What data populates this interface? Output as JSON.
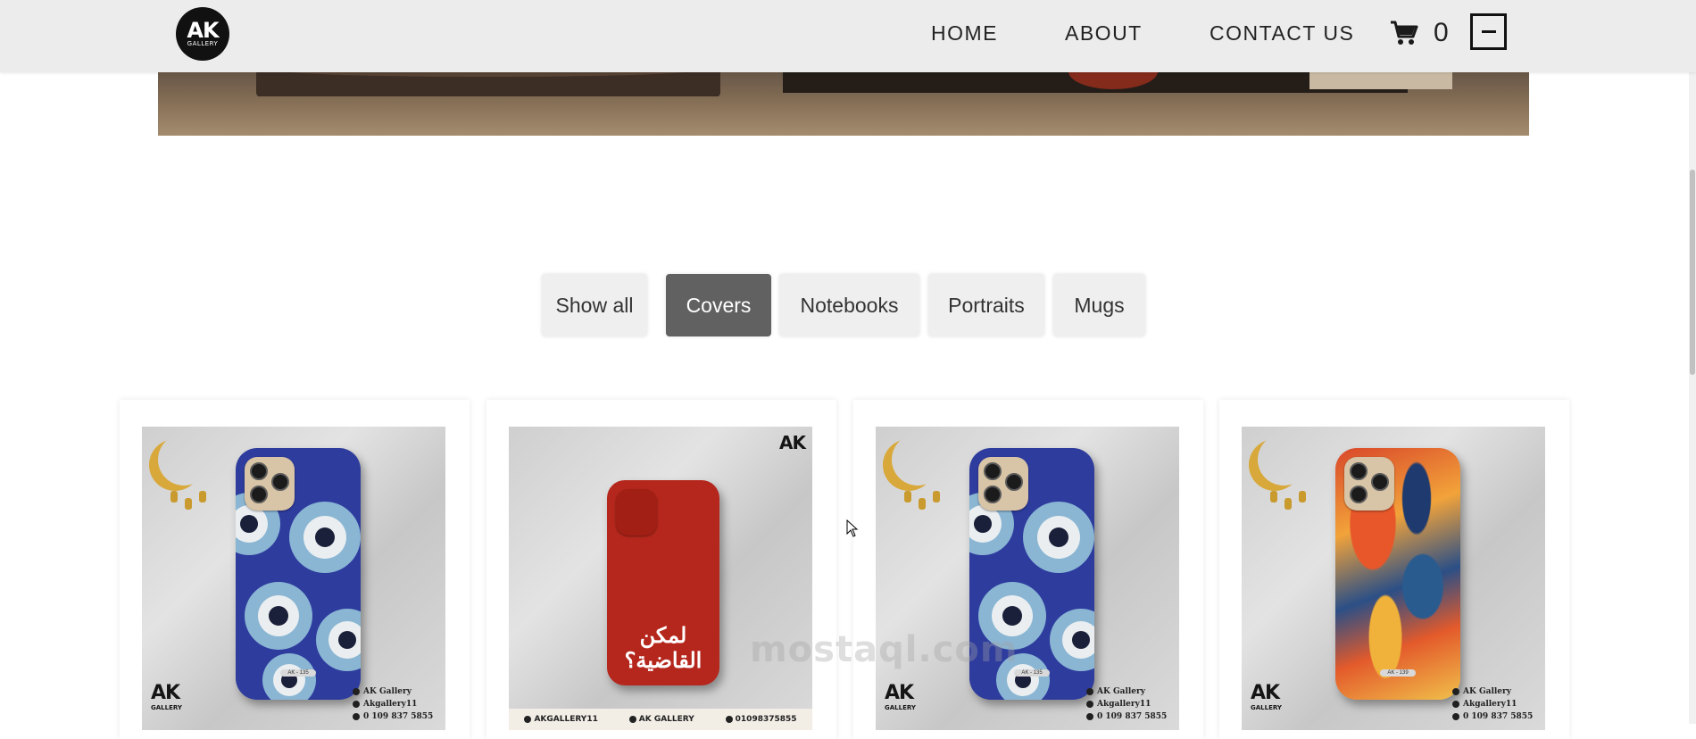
{
  "navbar": {
    "logo": {
      "main": "AK",
      "sub": "GALLERY"
    },
    "links": [
      "HOME",
      "ABOUT",
      "CONTACT US"
    ],
    "cart_count": "0",
    "cart_icon": "cart-icon",
    "menu_icon": "minus-icon"
  },
  "filters": {
    "buttons": [
      "Show all",
      "Covers",
      "Notebooks",
      "Portraits",
      "Mugs"
    ],
    "active": "Covers"
  },
  "products": [
    {
      "design": "evil-eye",
      "brand_mark": "AK",
      "brand_sub": "GALLERY",
      "code": "AK - 135",
      "social": [
        "AK Gallery",
        "Akgallery11",
        "0 109 837 5855"
      ]
    },
    {
      "design": "al-ahly",
      "brand_mark": "AK",
      "arabic_text": "لمكن القاضية؟",
      "footer": [
        "AKGALLERY11",
        "AK GALLERY",
        "01098375855"
      ]
    },
    {
      "design": "evil-eye",
      "brand_mark": "AK",
      "brand_sub": "GALLERY",
      "code": "AK - 135",
      "social": [
        "AK Gallery",
        "Akgallery11",
        "0 109 837 5855"
      ]
    },
    {
      "design": "abstract",
      "brand_mark": "AK",
      "brand_sub": "GALLERY",
      "code": "AK - 139",
      "social": [
        "AK Gallery",
        "Akgallery11",
        "0 109 837 5855"
      ]
    }
  ],
  "watermark": "mostaql.com",
  "colors": {
    "navbar_bg": "#ececec",
    "active_filter": "#616161",
    "filter_bg": "#efefef"
  }
}
